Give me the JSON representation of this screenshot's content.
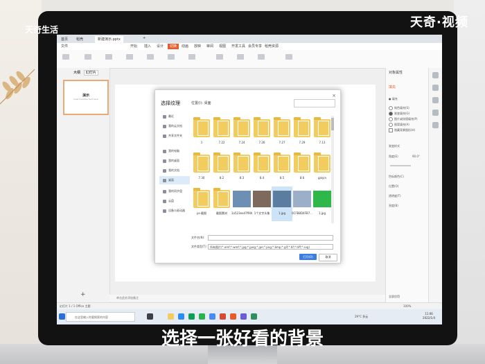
{
  "watermark": {
    "left": "天奇生活",
    "right": "天奇·视频"
  },
  "caption": "选择一张好看的背景",
  "app": {
    "tabs": [
      "首页",
      "稻壳",
      "新建演示.pptx"
    ],
    "menu": [
      "文件",
      "开始",
      "插入",
      "设计",
      "切换",
      "动画",
      "放映",
      "审阅",
      "视图",
      "开发工具",
      "会员专享",
      "稻壳资源"
    ],
    "menu_active_index": 4,
    "left_pane_tabs": [
      "大纲",
      "幻灯片"
    ],
    "slide_thumb": {
      "title": "演示",
      "subtitle": "Insert subtitle text here"
    },
    "add_slide": "+",
    "notes_placeholder": "单击此处添加备注",
    "status_left": "幻灯片 1 / 1   Office 主题",
    "zoom": "100%"
  },
  "right_pane": {
    "title": "对象属性",
    "tab": "填充",
    "section": "● 填充",
    "options": [
      "纯色填充(S)",
      "渐变填充(G)",
      "图片或纹理填充(P)",
      "图案填充(A)",
      "隐藏背景图形(H)"
    ],
    "labels": [
      "渐变样式",
      "角度(E)",
      "色标颜色(C)",
      "位置(O)",
      "透明度(T)",
      "亮度(B)"
    ],
    "angle_value": "90.0°",
    "apply_all": "全部应用"
  },
  "dialog": {
    "title": "选择纹理",
    "path": "位置(I):  桌面",
    "sidebar": [
      "最近",
      "我的云文档",
      "共享文件夹",
      "我的电脑",
      "我的桌面",
      "我的文档",
      "桌面",
      "我的同步盘",
      "云盘",
      "设备与驱动器"
    ],
    "sidebar_active_index": 6,
    "rows": [
      [
        {
          "name": "1",
          "type": "folder"
        },
        {
          "name": "7.22",
          "type": "folder"
        },
        {
          "name": "7.24",
          "type": "folder"
        },
        {
          "name": "7.26",
          "type": "folder"
        },
        {
          "name": "7.27",
          "type": "folder"
        },
        {
          "name": "7.29",
          "type": "folder"
        },
        {
          "name": "7.13",
          "type": "folder"
        }
      ],
      [
        {
          "name": "7.30",
          "type": "folder"
        },
        {
          "name": "8.2",
          "type": "folder"
        },
        {
          "name": "8.3",
          "type": "folder"
        },
        {
          "name": "8.4",
          "type": "folder"
        },
        {
          "name": "8.5",
          "type": "folder"
        },
        {
          "name": "8.6",
          "type": "folder"
        },
        {
          "name": "gaiyin",
          "type": "folder"
        }
      ],
      [
        {
          "name": "ps-截图",
          "type": "folder"
        },
        {
          "name": "截图素材",
          "type": "folder"
        },
        {
          "name": "1a523ee47f9061...",
          "type": "image"
        },
        {
          "name": "1个文字头像",
          "type": "image"
        },
        {
          "name": "1.jpg",
          "type": "image"
        },
        {
          "name": "0CFB8D4FB7...",
          "type": "image"
        },
        {
          "name": "1.jpg",
          "type": "image"
        }
      ]
    ],
    "selected": {
      "row": 2,
      "col": 4
    },
    "filename_label": "文件名(N):",
    "filename_value": "",
    "filetype_label": "文件类型(T):",
    "filetype_value": "所有图片(*.emf;*.wmf;*.jpg;*.jpeg;*.jpe;*.png;*.bmp;*.gif;*.tif;*.tiff;*.svg)",
    "open_button": "打开(O)",
    "cancel_button": "取消"
  },
  "taskbar": {
    "search_placeholder": "在这里输入你要搜索的内容",
    "weather": "29°C 多云",
    "time": "11:06",
    "date": "2022/1/4"
  },
  "colors": {
    "accent": "#e85b2a",
    "folder": "#f2cc5e",
    "dialog_button": "#3b7de0",
    "bezel": "#121212"
  }
}
